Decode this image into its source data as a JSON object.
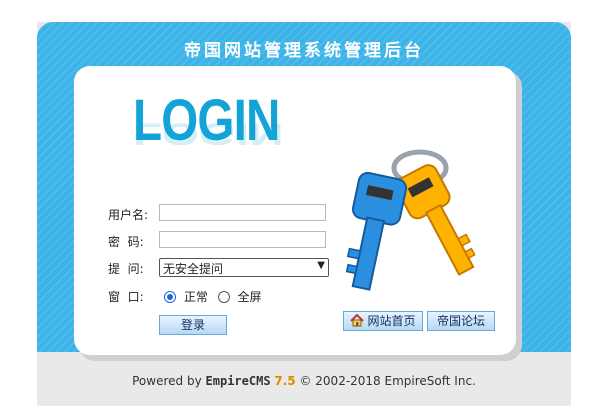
{
  "window": {
    "title": "帝国网站管理系统管理后台"
  },
  "logo": {
    "text": "LOGIN"
  },
  "form": {
    "username_label": "用户名:",
    "username_value": "",
    "password_label": "密  码:",
    "password_value": "",
    "question_label": "提  问:",
    "question_selected": "无安全提问",
    "window_label": "窗  口:",
    "window_options": [
      "正常",
      "全屏"
    ],
    "window_selected": "正常",
    "login_button": "登录"
  },
  "links": {
    "homepage_button": "网站首页",
    "forum_button": "帝国论坛"
  },
  "footer": {
    "prefix": "Powered by",
    "product": "EmpireCMS",
    "version": "7.5",
    "copyright": "© 2002-2018",
    "company": "EmpireSoft Inc."
  },
  "colors": {
    "header_blue": "#3bb3e8",
    "logo_blue": "#14a3d6",
    "version_orange": "#e08a00"
  },
  "icons": {
    "keys_illustration": "keys-icon",
    "home": "home-icon"
  }
}
